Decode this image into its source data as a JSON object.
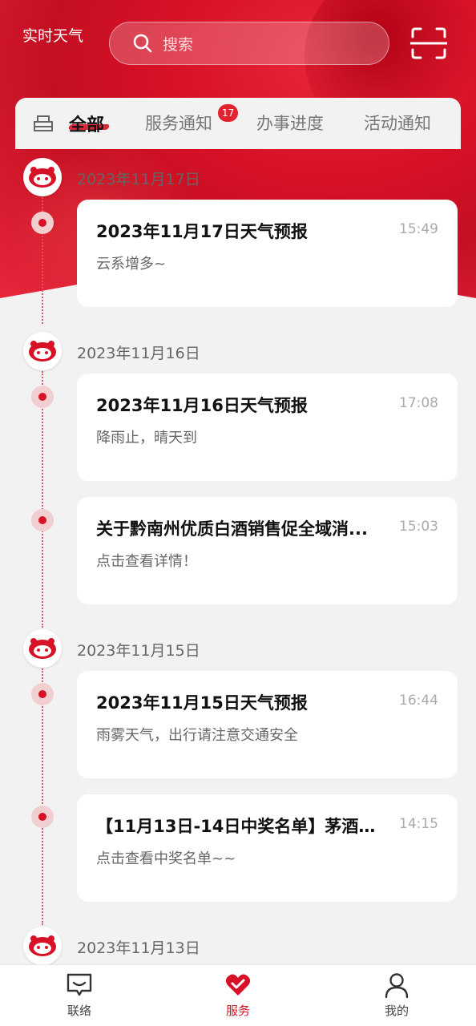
{
  "header": {
    "weather_link": "实时天气",
    "search_placeholder": "搜索"
  },
  "tabs": [
    {
      "label": "全部",
      "active": true
    },
    {
      "label": "服务通知",
      "badge": "17"
    },
    {
      "label": "办事进度"
    },
    {
      "label": "活动通知"
    }
  ],
  "groups": [
    {
      "date": "2023年11月17日",
      "messages": [
        {
          "title": "2023年11月17日天气预报",
          "time": "15:49",
          "subtitle": "云系增多~"
        }
      ]
    },
    {
      "date": "2023年11月16日",
      "messages": [
        {
          "title": "2023年11月16日天气预报",
          "time": "17:08",
          "subtitle": "降雨止，晴天到"
        },
        {
          "title": "关于黔南州优质白酒销售促全域消...",
          "time": "15:03",
          "subtitle": "点击查看详情！"
        }
      ]
    },
    {
      "date": "2023年11月15日",
      "messages": [
        {
          "title": "2023年11月15日天气预报",
          "time": "16:44",
          "subtitle": "雨雾天气，出行请注意交通安全"
        },
        {
          "title": "【11月13日-14日中奖名单】茅酒积...",
          "time": "14:15",
          "subtitle": "点击查看中奖名单~~"
        }
      ]
    },
    {
      "date": "2023年11月13日",
      "messages": []
    }
  ],
  "bottom_nav": [
    {
      "label": "联络",
      "icon": "chat-icon"
    },
    {
      "label": "服务",
      "icon": "service-heart-icon",
      "active": true
    },
    {
      "label": "我的",
      "icon": "profile-icon"
    }
  ],
  "colors": {
    "brand_red": "#d71126",
    "badge_red": "#e2232f"
  }
}
